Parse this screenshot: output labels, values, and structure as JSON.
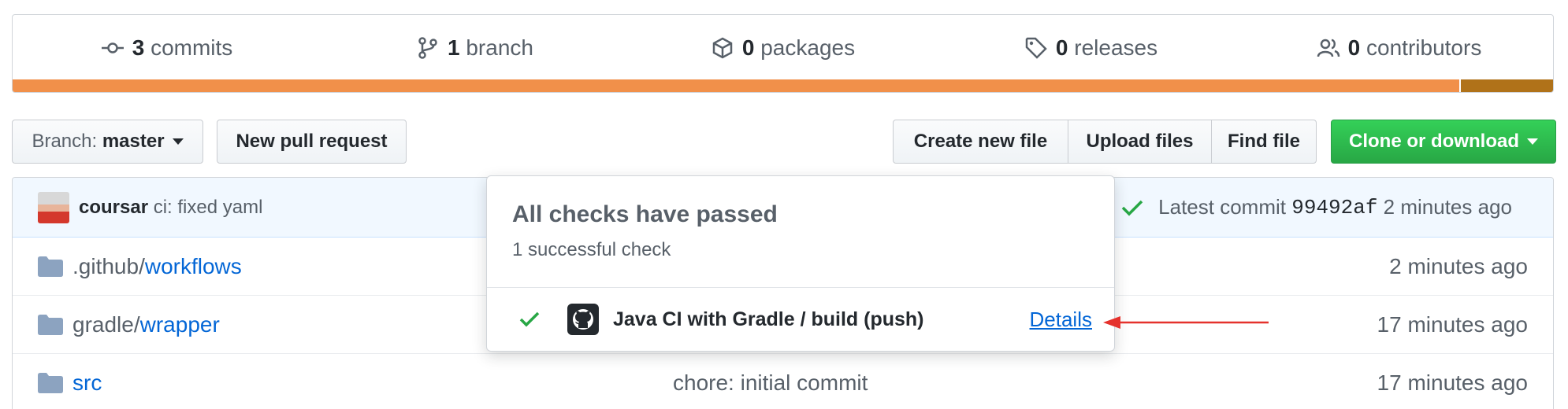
{
  "summary": {
    "commits": {
      "count": "3",
      "label": "commits",
      "icon": "commit-icon"
    },
    "branches": {
      "count": "1",
      "label": "branch",
      "icon": "branch-icon"
    },
    "packages": {
      "count": "0",
      "label": "packages",
      "icon": "package-icon"
    },
    "releases": {
      "count": "0",
      "label": "releases",
      "icon": "tag-icon"
    },
    "contributors": {
      "count": "0",
      "label": "contributors",
      "icon": "people-icon"
    },
    "language_bar": [
      {
        "color": "#f1904a",
        "fraction": 0.939
      },
      {
        "color": "#b07219",
        "fraction": 0.061
      }
    ]
  },
  "actions": {
    "branch_prefix": "Branch:",
    "branch_name": "master",
    "new_pull_request": "New pull request",
    "create_new_file": "Create new file",
    "upload_files": "Upload files",
    "find_file": "Find file",
    "clone_or_download": "Clone or download"
  },
  "latest_commit": {
    "author": "coursar",
    "message": "ci: fixed yaml",
    "prefix": "Latest commit",
    "sha": "99492af",
    "age": "2 minutes ago"
  },
  "files": [
    {
      "prefix": ".github/",
      "name": "workflows",
      "message": "",
      "age": "2 minutes ago"
    },
    {
      "prefix": "gradle/",
      "name": "wrapper",
      "message": "",
      "age": "17 minutes ago"
    },
    {
      "prefix": "",
      "name": "src",
      "message": "chore: initial commit",
      "age": "17 minutes ago"
    }
  ],
  "checks_popover": {
    "title": "All checks have passed",
    "subtitle": "1 successful check",
    "check_name": "Java CI with Gradle / build (push)",
    "details_link": "Details"
  },
  "colors": {
    "green_button": "#2cbe4e",
    "success": "#28a745",
    "link": "#0366d6",
    "annotation_arrow": "#e5322d"
  }
}
